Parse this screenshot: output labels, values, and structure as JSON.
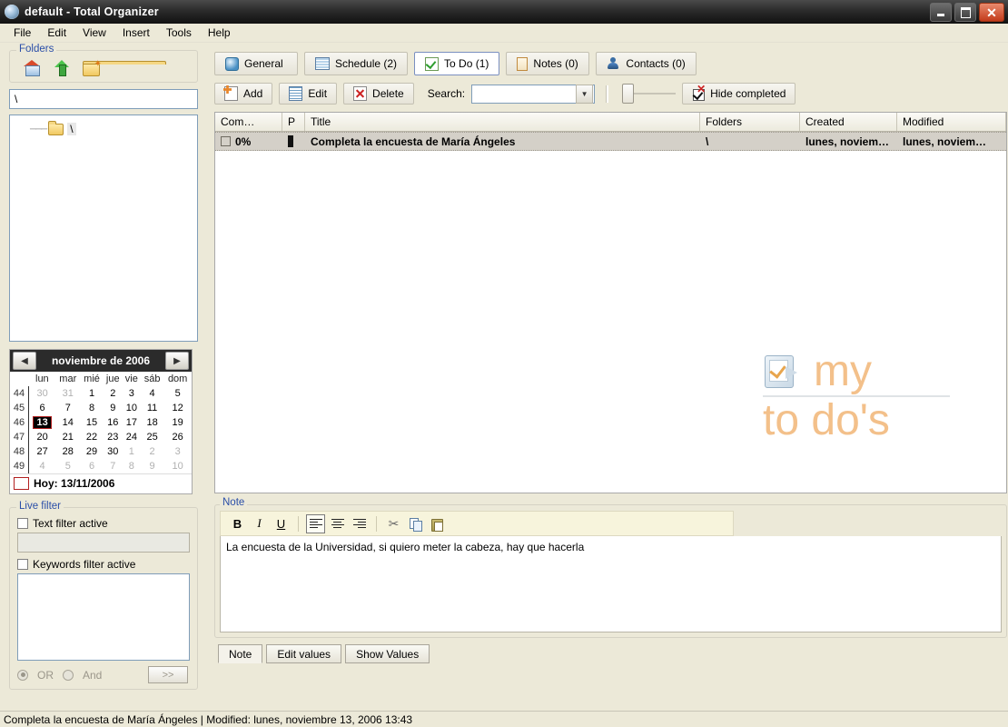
{
  "window": {
    "title": "default - Total Organizer",
    "minimize_label": "Minimize",
    "maximize_label": "Restore",
    "close_label": "Close"
  },
  "menubar": [
    "File",
    "Edit",
    "View",
    "Insert",
    "Tools",
    "Help"
  ],
  "sidebar": {
    "folders_group": {
      "title": "Folders",
      "icons": [
        "home-icon",
        "up-folder-icon",
        "new-folder-icon"
      ],
      "path_value": "\\",
      "tree": [
        {
          "label": "\\",
          "icon": "folder-icon"
        }
      ]
    },
    "calendar": {
      "prev_label": "◀",
      "next_label": "▶",
      "title": "noviembre de 2006",
      "weekday_header": [
        "lun",
        "mar",
        "mié",
        "jue",
        "vie",
        "sáb",
        "dom"
      ],
      "weeks": [
        {
          "wk": "44",
          "days": [
            {
              "d": "30",
              "out": true
            },
            {
              "d": "31",
              "out": true
            },
            {
              "d": "1"
            },
            {
              "d": "2"
            },
            {
              "d": "3"
            },
            {
              "d": "4"
            },
            {
              "d": "5"
            }
          ]
        },
        {
          "wk": "45",
          "days": [
            {
              "d": "6"
            },
            {
              "d": "7"
            },
            {
              "d": "8"
            },
            {
              "d": "9"
            },
            {
              "d": "10"
            },
            {
              "d": "11"
            },
            {
              "d": "12"
            }
          ]
        },
        {
          "wk": "46",
          "days": [
            {
              "d": "13",
              "selected": true
            },
            {
              "d": "14"
            },
            {
              "d": "15"
            },
            {
              "d": "16"
            },
            {
              "d": "17"
            },
            {
              "d": "18"
            },
            {
              "d": "19"
            }
          ]
        },
        {
          "wk": "47",
          "days": [
            {
              "d": "20"
            },
            {
              "d": "21"
            },
            {
              "d": "22"
            },
            {
              "d": "23"
            },
            {
              "d": "24"
            },
            {
              "d": "25"
            },
            {
              "d": "26"
            }
          ]
        },
        {
          "wk": "48",
          "days": [
            {
              "d": "27"
            },
            {
              "d": "28"
            },
            {
              "d": "29"
            },
            {
              "d": "30"
            },
            {
              "d": "1",
              "out": true
            },
            {
              "d": "2",
              "out": true
            },
            {
              "d": "3",
              "out": true
            }
          ]
        },
        {
          "wk": "49",
          "days": [
            {
              "d": "4",
              "out": true
            },
            {
              "d": "5",
              "out": true
            },
            {
              "d": "6",
              "out": true
            },
            {
              "d": "7",
              "out": true
            },
            {
              "d": "8",
              "out": true
            },
            {
              "d": "9",
              "out": true
            },
            {
              "d": "10",
              "out": true
            }
          ]
        }
      ],
      "today_label": "Hoy: 13/11/2006",
      "selected_day_bg": "#000000",
      "selected_day_border": "#b22020"
    },
    "live_filter": {
      "title": "Live filter",
      "text_filter_label": "Text filter active",
      "text_filter_checked": false,
      "text_filter_value": "",
      "keywords_filter_label": "Keywords filter active",
      "keywords_filter_checked": false,
      "keywords_value": "",
      "or_label": "OR",
      "and_label": "And",
      "or_selected": true,
      "go_label": ">>"
    }
  },
  "main": {
    "tabs": [
      {
        "label": "General",
        "icon": "general-icon",
        "active": false
      },
      {
        "label": "Schedule (2)",
        "icon": "schedule-icon",
        "active": false
      },
      {
        "label": "To Do (1)",
        "icon": "todo-icon",
        "active": true
      },
      {
        "label": "Notes (0)",
        "icon": "notes-icon",
        "active": false
      },
      {
        "label": "Contacts (0)",
        "icon": "contacts-icon",
        "active": false
      }
    ],
    "toolbar": {
      "add_label": "Add",
      "edit_label": "Edit",
      "delete_label": "Delete",
      "search_label": "Search:",
      "search_value": "",
      "hide_completed_label": "Hide completed"
    },
    "list": {
      "columns": [
        "Com…",
        "P",
        "Title",
        "Folders",
        "Created",
        "Modified"
      ],
      "rows": [
        {
          "completed_checked": false,
          "complete": "0%",
          "priority": "high",
          "title": "Completa la encuesta de María Ángeles",
          "folders": "\\",
          "created": "lunes, noviem…",
          "modified": "lunes, noviem…",
          "selected": true
        }
      ]
    },
    "watermark": {
      "line1": "my",
      "line2": "to do's",
      "color": "#f3c08a"
    }
  },
  "note_panel": {
    "title": "Note",
    "toolbar": {
      "bold": "B",
      "italic": "I",
      "underline": "U",
      "align_left": "align-left-icon",
      "align_center": "align-center-icon",
      "align_right": "align-right-icon",
      "cut": "cut-icon",
      "copy": "copy-icon",
      "paste": "paste-icon"
    },
    "text": "La encuesta de la Universidad, si quiero meter la cabeza, hay que hacerla",
    "tabs": [
      {
        "label": "Note",
        "active": true
      },
      {
        "label": "Edit values",
        "active": false
      },
      {
        "label": "Show Values",
        "active": false
      }
    ]
  },
  "statusbar": {
    "text": "Completa la encuesta de María Ángeles | Modified: lunes, noviembre 13, 2006 13:43"
  }
}
